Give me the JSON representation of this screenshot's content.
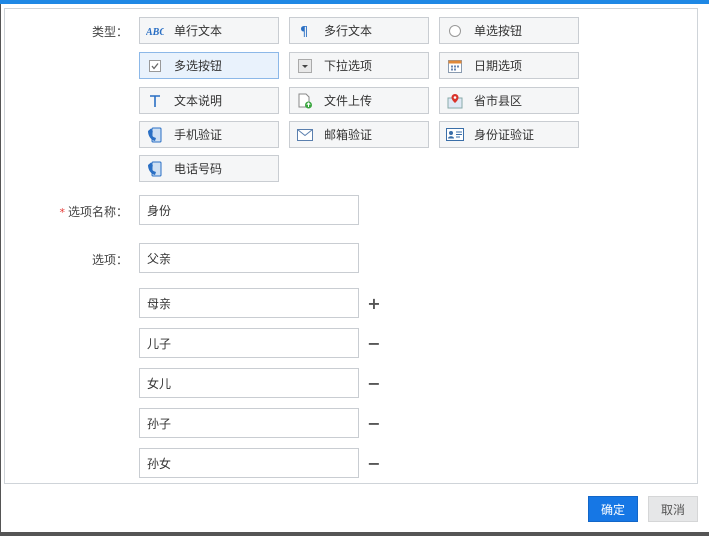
{
  "form": {
    "type_label": "类型：",
    "name_required_mark": "*",
    "name_label": "选项名称：",
    "name_value": "身份",
    "options_label": "选项：",
    "options": [
      "父亲",
      "母亲",
      "儿子",
      "女儿",
      "孙子",
      "孙女"
    ],
    "add_symbol": "+",
    "remove_symbol": "−"
  },
  "types": [
    {
      "label": "单行文本",
      "icon": "abc-text-icon"
    },
    {
      "label": "多行文本",
      "icon": "paragraph-icon"
    },
    {
      "label": "单选按钮",
      "icon": "radio-icon"
    },
    {
      "label": "多选按钮",
      "icon": "checkbox-icon",
      "selected": true
    },
    {
      "label": "下拉选项",
      "icon": "dropdown-icon"
    },
    {
      "label": "日期选项",
      "icon": "calendar-icon"
    },
    {
      "label": "文本说明",
      "icon": "text-t-icon"
    },
    {
      "label": "文件上传",
      "icon": "file-upload-icon"
    },
    {
      "label": "省市县区",
      "icon": "map-pin-icon"
    },
    {
      "label": "手机验证",
      "icon": "phone-icon"
    },
    {
      "label": "邮箱验证",
      "icon": "mail-icon"
    },
    {
      "label": "身份证验证",
      "icon": "id-card-icon"
    },
    {
      "label": "电话号码",
      "icon": "telephone-icon"
    }
  ],
  "footer": {
    "ok_label": "确定",
    "cancel_label": "取消"
  },
  "colors": {
    "accent": "#1677e5",
    "top_bar": "#1e88e5",
    "required": "#e53935"
  }
}
